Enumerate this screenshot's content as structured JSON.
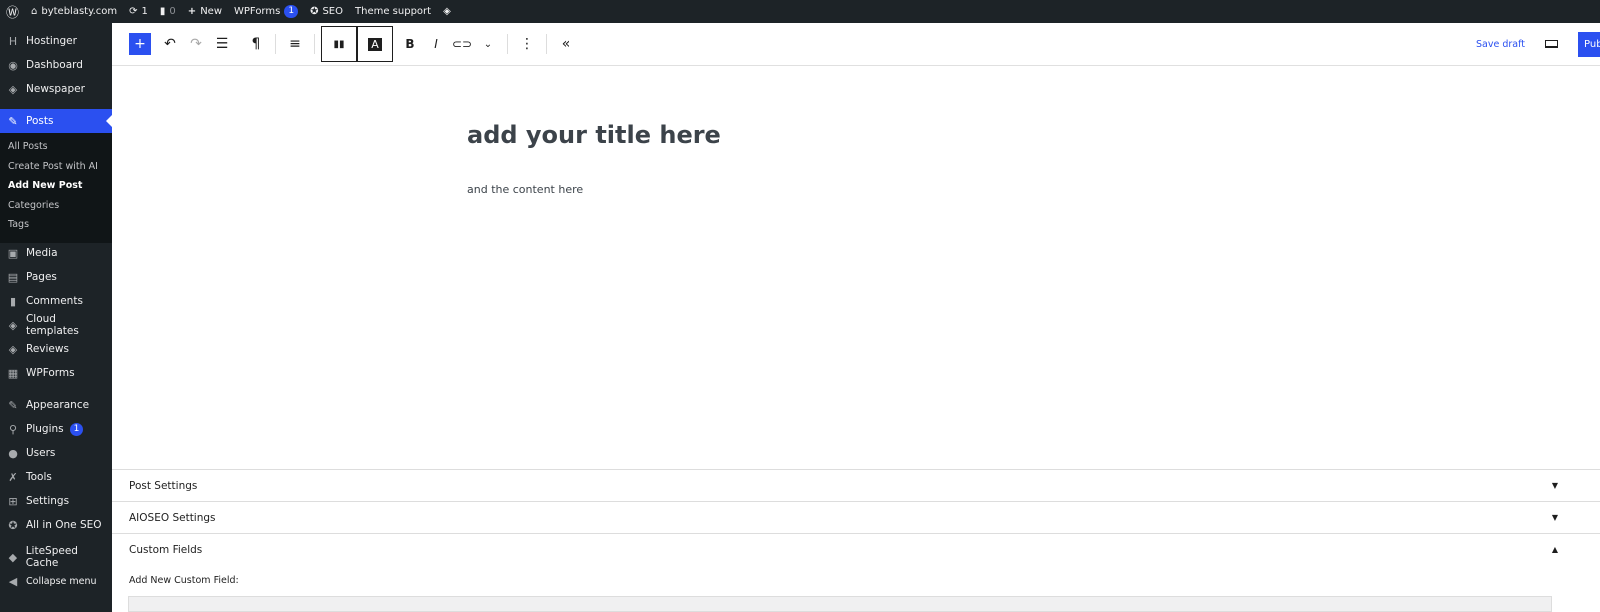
{
  "adminbar": {
    "site": "byteblasty.com",
    "updates": "1",
    "comments": "0",
    "new": "New",
    "wpforms": "WPForms",
    "wpforms_badge": "1",
    "seo": "SEO",
    "theme_support": "Theme support"
  },
  "sidebar": {
    "items": [
      {
        "label": "Hostinger",
        "icon": "H"
      },
      {
        "label": "Dashboard",
        "icon": "◉"
      },
      {
        "label": "Newspaper",
        "icon": "◈"
      },
      {
        "label": "Posts",
        "icon": "✎"
      },
      {
        "label": "Media",
        "icon": "▣"
      },
      {
        "label": "Pages",
        "icon": "▤"
      },
      {
        "label": "Comments",
        "icon": "▮"
      },
      {
        "label": "Cloud templates",
        "icon": "◈"
      },
      {
        "label": "Reviews",
        "icon": "◈"
      },
      {
        "label": "WPForms",
        "icon": "▦"
      },
      {
        "label": "Appearance",
        "icon": "✎"
      },
      {
        "label": "Plugins",
        "icon": "⚲",
        "badge": "1"
      },
      {
        "label": "Users",
        "icon": "●"
      },
      {
        "label": "Tools",
        "icon": "✗"
      },
      {
        "label": "Settings",
        "icon": "⊞"
      },
      {
        "label": "All in One SEO",
        "icon": "✪"
      },
      {
        "label": "LiteSpeed Cache",
        "icon": "◆"
      },
      {
        "label": "Collapse menu",
        "icon": "◀"
      }
    ],
    "submenu": [
      "All Posts",
      "Create Post with AI",
      "Add New Post",
      "Categories",
      "Tags"
    ]
  },
  "toolbar": {
    "save_draft": "Save draft",
    "publish": "Publish"
  },
  "editor": {
    "title": "add your title here",
    "content": "and the content here"
  },
  "panels": {
    "post_settings": "Post Settings",
    "aioseo": "AIOSEO Settings",
    "custom_fields": "Custom Fields",
    "add_new_custom_field": "Add New Custom Field:"
  },
  "colors": {
    "accent": "#2b50f0",
    "admin_bg": "#1d2327"
  }
}
